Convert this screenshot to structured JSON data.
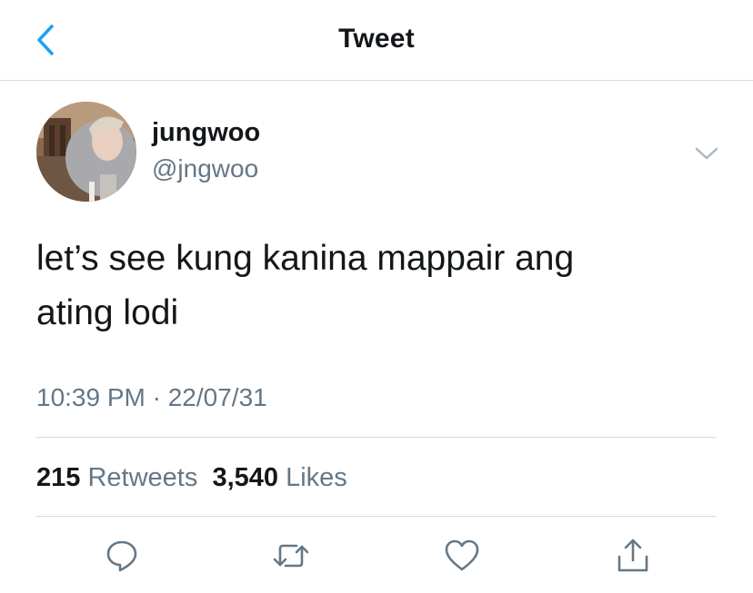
{
  "header": {
    "title": "Tweet",
    "back_icon": "chevron-left-icon"
  },
  "tweet": {
    "author": {
      "display_name": "jungwoo",
      "handle": "@jngwoo"
    },
    "text_line1": "let’s see kung kanina mappair ang",
    "text_line2": "ating lodi",
    "timestamp": "10:39 PM · 22/07/31",
    "stats": {
      "retweets_count": "215",
      "retweets_label": "Retweets",
      "likes_count": "3,540",
      "likes_label": "Likes"
    }
  },
  "actions": [
    "reply-icon",
    "retweet-icon",
    "like-icon",
    "share-icon"
  ],
  "colors": {
    "accent": "#1da1f2",
    "text_primary": "#14171a",
    "text_secondary": "#657786",
    "divider": "#d6d9dc"
  }
}
